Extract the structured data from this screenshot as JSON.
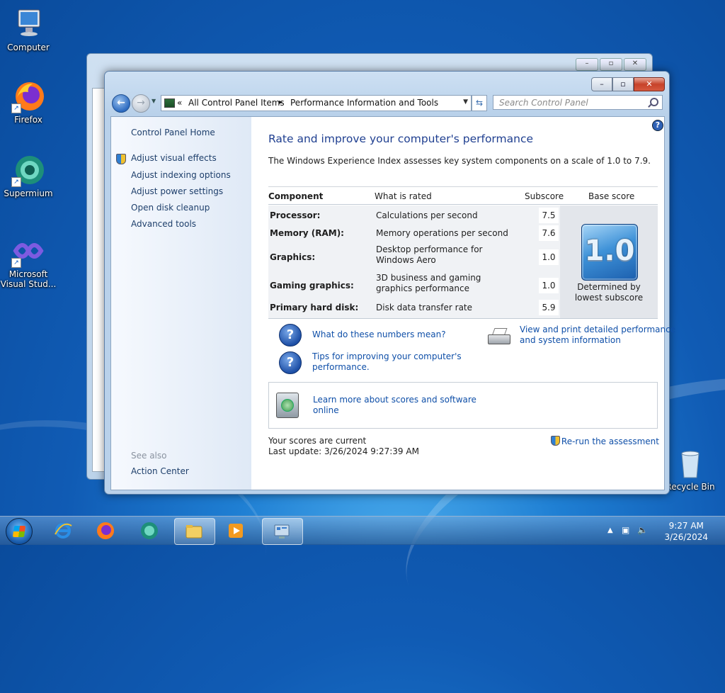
{
  "desktop": {
    "icons": [
      {
        "label": "Computer"
      },
      {
        "label": "Firefox"
      },
      {
        "label": "Supermium"
      },
      {
        "label": "Microsoft Visual Stud..."
      },
      {
        "label": "Recycle Bin"
      }
    ]
  },
  "window": {
    "caption_buttons": {
      "minimize": "–",
      "maximize": "▫",
      "close": "✕"
    },
    "address": {
      "chevron": "«",
      "crumb1": "All Control Panel Items",
      "separator": "▸",
      "crumb2": "Performance Information and Tools"
    },
    "search_placeholder": "Search Control Panel"
  },
  "left_pane": {
    "home": "Control Panel Home",
    "links": [
      "Adjust visual effects",
      "Adjust indexing options",
      "Adjust power settings",
      "Open disk cleanup",
      "Advanced tools"
    ],
    "see_also": "See also",
    "action_center": "Action Center"
  },
  "main": {
    "title": "Rate and improve your computer's performance",
    "intro": "The Windows Experience Index assesses key system components on a scale of 1.0 to 7.9.",
    "table": {
      "headers": {
        "component": "Component",
        "rated": "What is rated",
        "subscore": "Subscore",
        "base": "Base score"
      },
      "rows": [
        {
          "component": "Processor:",
          "rated": "Calculations per second",
          "subscore": "7.5"
        },
        {
          "component": "Memory (RAM):",
          "rated": "Memory operations per second",
          "subscore": "7.6"
        },
        {
          "component": "Graphics:",
          "rated_l1": "Desktop performance for",
          "rated_l2": "Windows Aero",
          "subscore": "1.0"
        },
        {
          "component": "Gaming graphics:",
          "rated_l1": "3D business and gaming",
          "rated_l2": "graphics performance",
          "subscore": "1.0"
        },
        {
          "component": "Primary hard disk:",
          "rated": "Disk data transfer rate",
          "subscore": "5.9"
        }
      ],
      "base_score": "1.0",
      "determined_l1": "Determined by",
      "determined_l2": "lowest subscore"
    },
    "links": {
      "numbers": "What do these numbers mean?",
      "tips_l1": "Tips for improving your computer's",
      "tips_l2": "performance.",
      "view_l1": "View and print detailed performance",
      "view_l2": "and system information",
      "learn_l1": "Learn more about scores and software",
      "learn_l2": "online"
    },
    "status_l1": "Your scores are current",
    "status_l2": "Last update: 3/26/2024 9:27:39 AM",
    "rerun": "Re-run the assessment"
  },
  "taskbar": {
    "time": "9:27 AM",
    "date": "3/26/2024"
  }
}
